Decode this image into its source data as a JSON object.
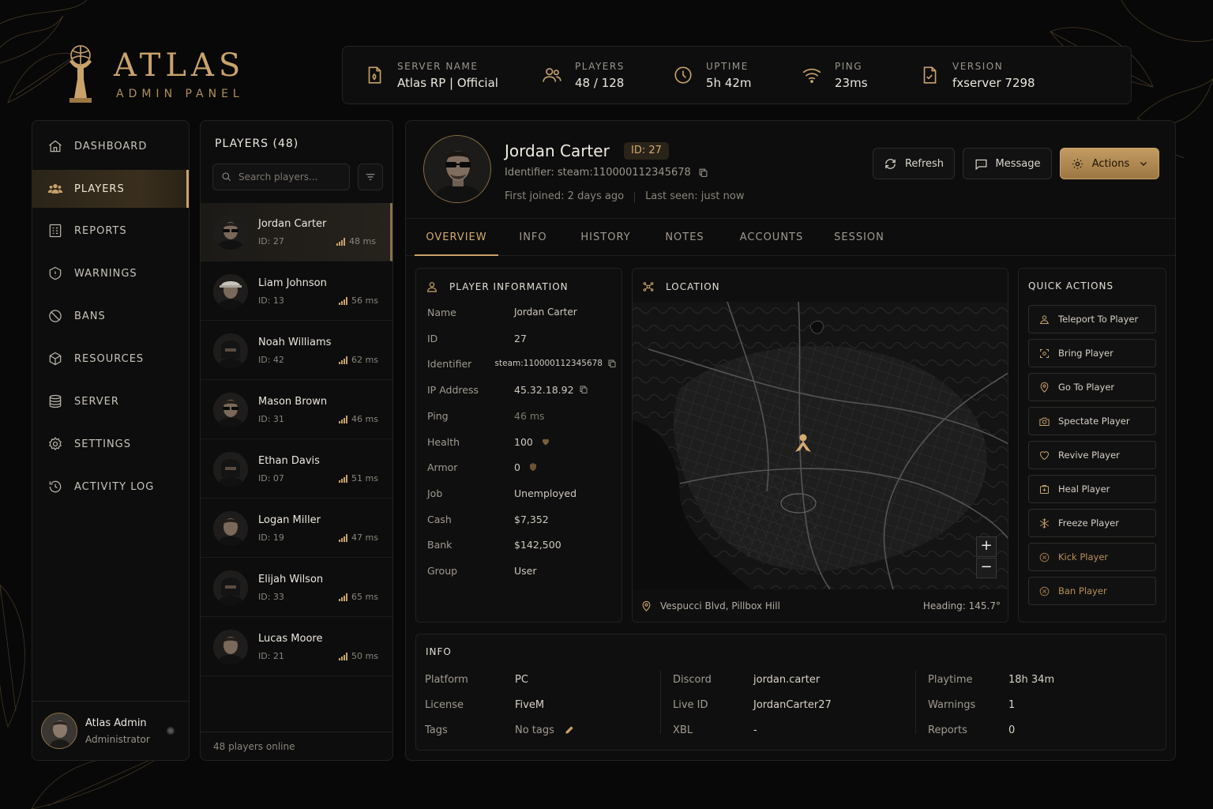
{
  "brand": {
    "title": "ATLAS",
    "subtitle": "ADMIN PANEL"
  },
  "stats": [
    {
      "label": "SERVER NAME",
      "value": "Atlas RP | Official",
      "icon": "server-file-icon"
    },
    {
      "label": "PLAYERS",
      "value": "48 / 128",
      "icon": "users-icon"
    },
    {
      "label": "UPTIME",
      "value": "5h 42m",
      "icon": "clock-icon"
    },
    {
      "label": "PING",
      "value": "23ms",
      "icon": "wifi-icon"
    },
    {
      "label": "VERSION",
      "value": "fxserver 7298",
      "icon": "version-file-icon"
    }
  ],
  "nav": [
    {
      "label": "DASHBOARD",
      "icon": "home-icon"
    },
    {
      "label": "PLAYERS",
      "icon": "players-icon",
      "active": true
    },
    {
      "label": "REPORTS",
      "icon": "reports-icon"
    },
    {
      "label": "WARNINGS",
      "icon": "warning-icon"
    },
    {
      "label": "BANS",
      "icon": "ban-icon"
    },
    {
      "label": "RESOURCES",
      "icon": "cube-icon"
    },
    {
      "label": "SERVER",
      "icon": "database-icon"
    },
    {
      "label": "SETTINGS",
      "icon": "gear-icon"
    },
    {
      "label": "ACTIVITY LOG",
      "icon": "history-icon"
    }
  ],
  "admin": {
    "name": "Atlas Admin",
    "role": "Administrator"
  },
  "players_panel": {
    "title": "PLAYERS (48)",
    "search_placeholder": "Search players...",
    "footer": "48 players online",
    "players": [
      {
        "name": "Jordan Carter",
        "id": "ID: 27",
        "ping": "48 ms",
        "look": "sunglasses"
      },
      {
        "name": "Liam Johnson",
        "id": "ID: 13",
        "ping": "56 ms",
        "look": "cap"
      },
      {
        "name": "Noah Williams",
        "id": "ID: 42",
        "ping": "62 ms",
        "look": "mask"
      },
      {
        "name": "Mason Brown",
        "id": "ID: 31",
        "ping": "46 ms",
        "look": "sunglasses"
      },
      {
        "name": "Ethan Davis",
        "id": "ID: 07",
        "ping": "51 ms",
        "look": "mask"
      },
      {
        "name": "Logan Miller",
        "id": "ID: 19",
        "ping": "47 ms",
        "look": "plain"
      },
      {
        "name": "Elijah Wilson",
        "id": "ID: 33",
        "ping": "65 ms",
        "look": "mask"
      },
      {
        "name": "Lucas Moore",
        "id": "ID: 21",
        "ping": "50 ms",
        "look": "plain"
      }
    ]
  },
  "player": {
    "name": "Jordan Carter",
    "id_badge": "ID: 27",
    "identifier": "Identifier: steam:110000112345678",
    "first_joined": "First joined: 2 days ago",
    "last_seen": "Last seen: just now"
  },
  "buttons": {
    "refresh": "Refresh",
    "message": "Message",
    "actions": "Actions"
  },
  "tabs": [
    "OVERVIEW",
    "INFO",
    "HISTORY",
    "NOTES",
    "ACCOUNTS",
    "SESSION"
  ],
  "player_info": {
    "title": "PLAYER INFORMATION",
    "rows": [
      {
        "k": "Name",
        "v": "Jordan Carter"
      },
      {
        "k": "ID",
        "v": "27"
      },
      {
        "k": "Identifier",
        "v": "steam:110000112345678"
      },
      {
        "k": "IP Address",
        "v": "45.32.18.92"
      },
      {
        "k": "Ping",
        "v": "46 ms"
      },
      {
        "k": "Health",
        "v": "100"
      },
      {
        "k": "Armor",
        "v": "0"
      },
      {
        "k": "Job",
        "v": "Unemployed"
      },
      {
        "k": "Cash",
        "v": "$7,352"
      },
      {
        "k": "Bank",
        "v": "$142,500"
      },
      {
        "k": "Group",
        "v": "User"
      }
    ]
  },
  "location": {
    "title": "LOCATION",
    "address": "Vespucci Blvd, Pillbox Hill",
    "heading": "Heading: 145.7°",
    "zoom_in": "+",
    "zoom_out": "−"
  },
  "quick_actions": {
    "title": "QUICK ACTIONS",
    "items": [
      {
        "label": "Teleport To Player",
        "icon": "teleport-icon"
      },
      {
        "label": "Bring Player",
        "icon": "bring-icon"
      },
      {
        "label": "Go To Player",
        "icon": "pin-icon"
      },
      {
        "label": "Spectate Player",
        "icon": "camera-icon"
      },
      {
        "label": "Revive Player",
        "icon": "heart-icon"
      },
      {
        "label": "Heal Player",
        "icon": "medkit-icon"
      },
      {
        "label": "Freeze Player",
        "icon": "snowflake-icon"
      },
      {
        "label": "Kick Player",
        "icon": "kick-icon",
        "danger": true
      },
      {
        "label": "Ban Player",
        "icon": "ban-icon",
        "danger": true
      }
    ]
  },
  "info": {
    "title": "INFO",
    "col1": [
      {
        "k": "Platform",
        "v": "PC"
      },
      {
        "k": "License",
        "v": "FiveM"
      },
      {
        "k": "Tags",
        "v": "No tags"
      }
    ],
    "col2": [
      {
        "k": "Discord",
        "v": "jordan.carter"
      },
      {
        "k": "Live ID",
        "v": "JordanCarter27"
      },
      {
        "k": "XBL",
        "v": "-"
      }
    ],
    "col3": [
      {
        "k": "Playtime",
        "v": "18h 34m"
      },
      {
        "k": "Warnings",
        "v": "1"
      },
      {
        "k": "Reports",
        "v": "0"
      }
    ]
  },
  "colors": {
    "accent": "#c9a36a",
    "accent_dark": "#9c7742",
    "background": "#080808",
    "panel": "#0d0d0d"
  }
}
